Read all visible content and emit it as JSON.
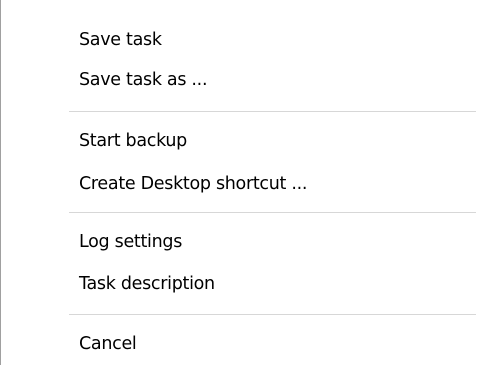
{
  "context_menu": {
    "items": [
      {
        "label": "Save task"
      },
      {
        "label": "Save task as ..."
      },
      {
        "label": "Start backup"
      },
      {
        "label": "Create Desktop shortcut ..."
      },
      {
        "label": "Log settings"
      },
      {
        "label": "Task description"
      },
      {
        "label": "Cancel"
      }
    ],
    "colors": {
      "background": "#ffffff",
      "separator": "#d7d7d7",
      "border": "#a0a0a0",
      "text": "#000000"
    }
  }
}
